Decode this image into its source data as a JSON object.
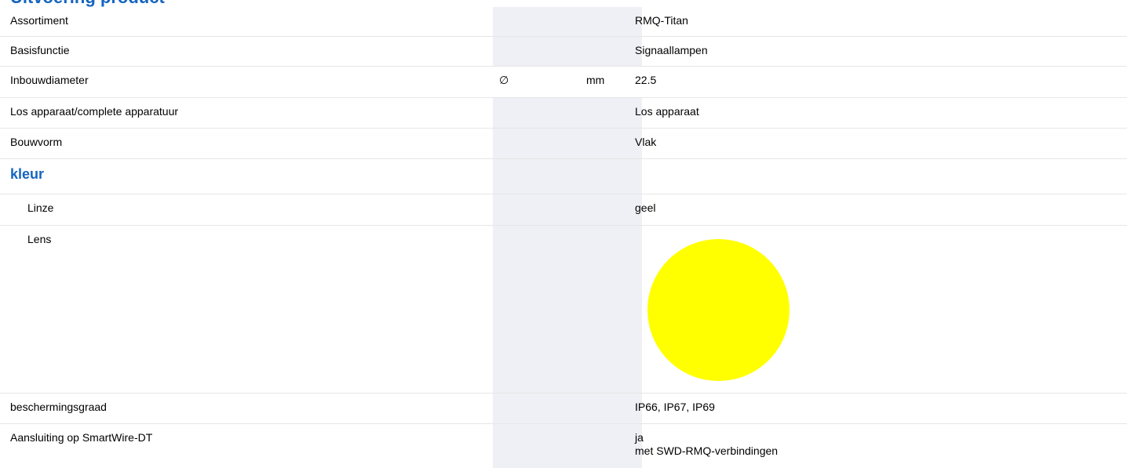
{
  "header": {
    "cutoff_title": "Uitvoering product"
  },
  "rows": [
    {
      "label": "Assortiment",
      "symbol": "",
      "unit": "",
      "value": "RMQ-Titan"
    },
    {
      "label": "Basisfunctie",
      "symbol": "",
      "unit": "",
      "value": "Signaallampen"
    },
    {
      "label": "Inbouwdiameter",
      "symbol": "∅",
      "unit": "mm",
      "value": "22.5"
    },
    {
      "label": "Los apparaat/complete apparatuur",
      "symbol": "",
      "unit": "",
      "value": "Los apparaat"
    },
    {
      "label": "Bouwvorm",
      "symbol": "",
      "unit": "",
      "value": "Vlak"
    }
  ],
  "section": {
    "title": "kleur"
  },
  "color_rows": [
    {
      "label": "Linze",
      "value": "geel"
    },
    {
      "label": "Lens",
      "swatch_name": "yellow-lens-swatch",
      "swatch_color": "#ffff00"
    }
  ],
  "bottom_rows": [
    {
      "label": "beschermingsgraad",
      "value": "IP66, IP67, IP69"
    },
    {
      "label": "Aansluiting op SmartWire-DT",
      "value_line1": "ja",
      "value_line2": "met SWD-RMQ-verbindingen"
    }
  ]
}
